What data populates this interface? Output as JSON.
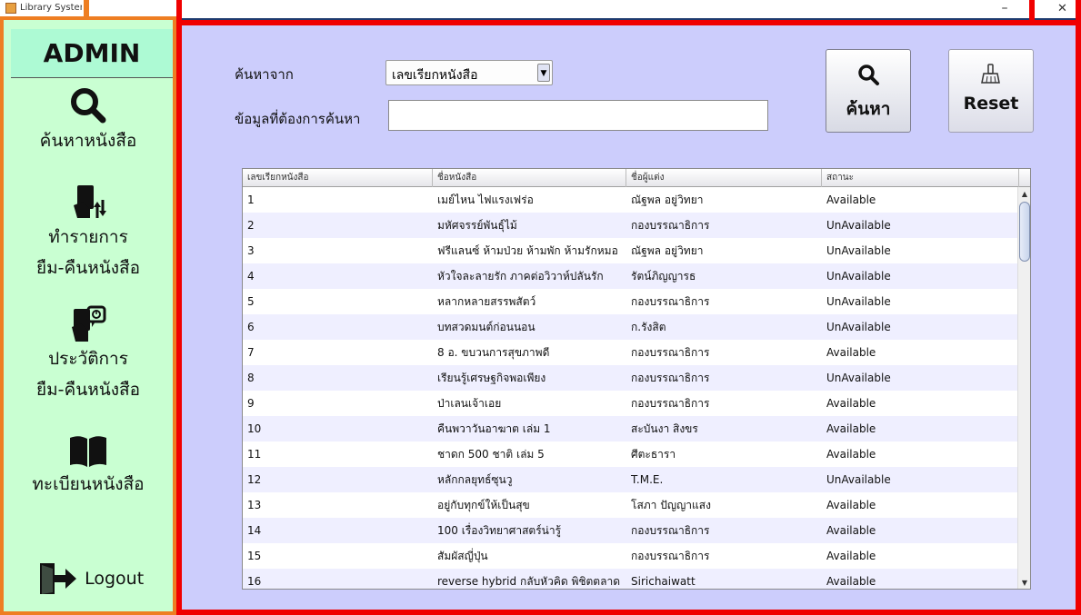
{
  "window": {
    "title": "Library System",
    "minimize": "–",
    "close": "✕"
  },
  "sidebar": {
    "header": "ADMIN",
    "items": [
      {
        "label": "ค้นหาหนังสือ",
        "icon": "search-icon"
      },
      {
        "label_line1": "ทำรายการ",
        "label_line2": "ยืม-คืนหนังสือ",
        "icon": "book-transfer-icon"
      },
      {
        "label_line1": "ประวัติการ",
        "label_line2": "ยืม-คืนหนังสือ",
        "icon": "book-history-icon"
      },
      {
        "label": "ทะเบียนหนังสือ",
        "icon": "open-book-icon"
      }
    ],
    "logout": "Logout"
  },
  "search": {
    "field_label": "ค้นหาจาก",
    "field_value": "เลขเรียกหนังสือ",
    "keyword_label": "ข้อมูลที่ต้องการค้นหา",
    "keyword_value": "",
    "search_button": "ค้นหา",
    "reset_button": "Reset"
  },
  "table": {
    "columns": [
      "เลขเรียกหนังสือ",
      "ชื่อหนังสือ",
      "ชื่อผู้แต่ง",
      "สถานะ"
    ],
    "rows": [
      [
        "1",
        "เมย์ไหน ไฟแรงเฟร่อ",
        "ณัฐพล อยู่วิทยา",
        "Available"
      ],
      [
        "2",
        "มหัศจรรย์พันธุ์ไม้",
        "กองบรรณาธิการ",
        "UnAvailable"
      ],
      [
        "3",
        "ฟรีแลนซ์ ห้ามป่วย ห้ามพัก ห้ามรักหมอ",
        "ณัฐพล อยู่วิทยา",
        "UnAvailable"
      ],
      [
        "4",
        "หัวใจละลายรัก ภาคต่อวิวาห์ปลันรัก",
        "รัตน์ภิญญารธ",
        "UnAvailable"
      ],
      [
        "5",
        "หลากหลายสรรพสัตว์",
        "กองบรรณาธิการ",
        "UnAvailable"
      ],
      [
        "6",
        "บทสวดมนต์ก่อนนอน",
        "ก.รังสิต",
        "UnAvailable"
      ],
      [
        "7",
        "8 อ. ขบวนการสุขภาพดี",
        "กองบรรณาธิการ",
        "Available"
      ],
      [
        "8",
        "เรียนรู้เศรษฐกิจพอเพียง",
        "กองบรรณาธิการ",
        "UnAvailable"
      ],
      [
        "9",
        "ป่าเลนเจ้าเอย",
        "กองบรรณาธิการ",
        "Available"
      ],
      [
        "10",
        "คืนพวาวันอาฆาต เล่ม 1",
        "สะบันงา สิงขร",
        "Available"
      ],
      [
        "11",
        "ชาดก 500 ชาติ เล่ม 5",
        "ศีตะธารา",
        "Available"
      ],
      [
        "12",
        "หลักกลยุทธ์ซุนวู",
        "T.M.E.",
        "UnAvailable"
      ],
      [
        "13",
        "อยู่กับทุกข์ให้เป็นสุข",
        "โสภา ปัญญาแสง",
        "Available"
      ],
      [
        "14",
        "100 เรื่องวิทยาศาสตร์น่ารู้",
        "กองบรรณาธิการ",
        "Available"
      ],
      [
        "15",
        "สัมผัสญี่ปุ่น",
        "กองบรรณาธิการ",
        "Available"
      ],
      [
        "16",
        "reverse hybrid กลับหัวคิด พิชิตตลาด",
        "Sirichaiwatt",
        "Available"
      ]
    ]
  },
  "colors": {
    "sidebar_bg": "#c9ffd2",
    "sidebar_border": "#ee7e22",
    "content_bg": "#cccdfc",
    "frame_red": "#f00000",
    "alt_row": "#efefff"
  }
}
